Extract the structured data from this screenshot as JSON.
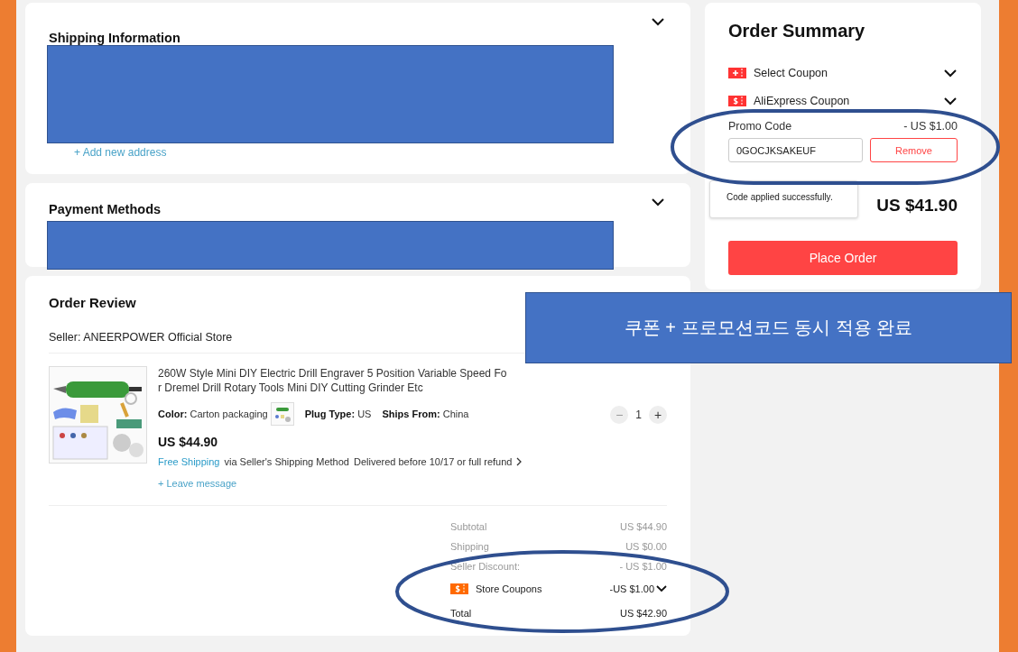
{
  "shipping": {
    "title": "Shipping Information",
    "add_address": "+ Add new address",
    "expanded": false
  },
  "payment": {
    "title": "Payment Methods",
    "expanded": false
  },
  "order_review": {
    "title": "Order Review",
    "seller": "Seller: ANEERPOWER Official Store",
    "product": {
      "kind": "picture",
      "title": "260W Style Mini DIY Electric Drill Engraver 5 Position Variable Speed Fo\nr Dremel Drill Rotary Tools Mini DIY Cutting Grinder Etc",
      "attributes": [
        {
          "label": "Color:",
          "value": "Carton packaging",
          "kind": "swatch"
        },
        {
          "label": "Plug Type:",
          "value": "US",
          "kind": "text"
        },
        {
          "label": "Ships From:",
          "value": "China",
          "kind": "text"
        }
      ],
      "price": "US $44.90",
      "shipping_free": "Free Shipping",
      "shipping_method": "via Seller's Shipping Method",
      "delivery": "Delivered before 10/17 or full refund",
      "leave_message": "+ Leave message",
      "minus": "−",
      "quantity": "1",
      "plus": "+"
    },
    "summary": [
      {
        "label": "Subtotal",
        "value": "US $44.90",
        "kind": "muted"
      },
      {
        "label": "Shipping",
        "value": "US $0.00",
        "kind": "muted"
      },
      {
        "label": "Seller Discount:",
        "value": "- US $1.00",
        "kind": "muted"
      },
      {
        "label": "Store Coupons",
        "value": "-US $1.00",
        "kind": "coupon"
      },
      {
        "label": "Total",
        "value": "US $42.90",
        "kind": "total"
      }
    ]
  },
  "order_summary": {
    "title": "Order Summary",
    "coupons": [
      {
        "label": "Select Coupon",
        "kind": "plus",
        "expanded": false
      },
      {
        "label": "AliExpress Coupon",
        "kind": "dollar",
        "expanded": false
      }
    ],
    "promo_label": "Promo Code",
    "promo_discount": "- US $1.00",
    "promo_value": "0GOCJKSAKEUF",
    "remove": "Remove",
    "tooltip": "Code applied successfully.",
    "total": "US $41.90",
    "place_order": "Place Order"
  },
  "annotation": {
    "caption": "쿠폰 + 프로모션코드 동시 적용 완료"
  }
}
